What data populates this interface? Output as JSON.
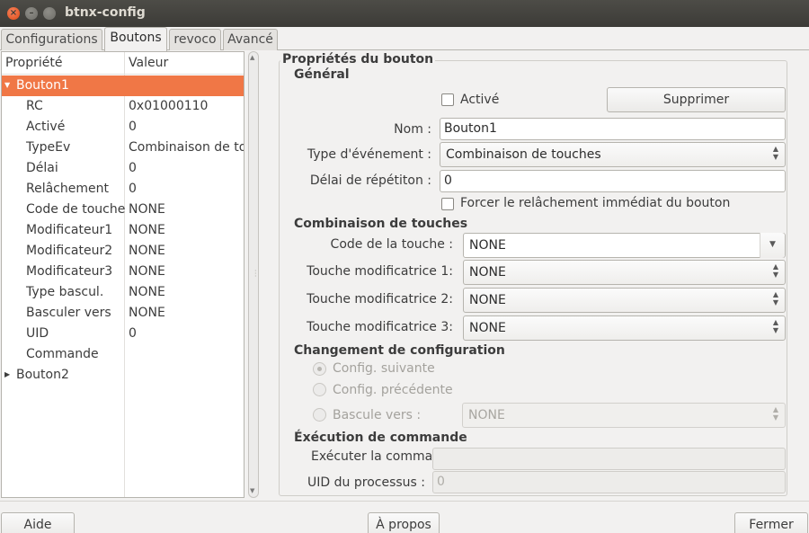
{
  "window": {
    "title": "btnx-config"
  },
  "tabs": [
    {
      "label": "Configurations"
    },
    {
      "label": "Boutons"
    },
    {
      "label": "revoco"
    },
    {
      "label": "Avancé"
    }
  ],
  "tree": {
    "headers": {
      "property": "Propriété",
      "value": "Valeur"
    },
    "rows": [
      {
        "prop": "Bouton1",
        "val": ""
      },
      {
        "prop": "RC",
        "val": "0x01000110"
      },
      {
        "prop": "Activé",
        "val": "0"
      },
      {
        "prop": "TypeEv",
        "val": "Combinaison de touches"
      },
      {
        "prop": "Délai",
        "val": "0"
      },
      {
        "prop": "Relâchement",
        "val": "0"
      },
      {
        "prop": "Code de touche",
        "val": "NONE"
      },
      {
        "prop": "Modificateur1",
        "val": "NONE"
      },
      {
        "prop": "Modificateur2",
        "val": "NONE"
      },
      {
        "prop": "Modificateur3",
        "val": "NONE"
      },
      {
        "prop": "Type bascul.",
        "val": "NONE"
      },
      {
        "prop": "Basculer vers",
        "val": "NONE"
      },
      {
        "prop": "UID",
        "val": "0"
      },
      {
        "prop": "Commande",
        "val": ""
      },
      {
        "prop": "Bouton2",
        "val": ""
      }
    ]
  },
  "props": {
    "frame_title": "Propriétés du bouton",
    "general": {
      "title": "Général",
      "enabled_label": "Activé",
      "enabled": false,
      "delete_label": "Supprimer",
      "name_label": "Nom :",
      "name_value": "Bouton1",
      "event_type_label": "Type d'événement :",
      "event_type_value": "Combinaison de touches",
      "repeat_delay_label": "Délai de répétiton :",
      "repeat_delay_value": "0",
      "force_release_label": "Forcer le relâchement immédiat du bouton"
    },
    "keycombo": {
      "title": "Combinaison de touches",
      "keycode_label": "Code de la touche :",
      "keycode_value": "NONE",
      "mod1_label": "Touche modificatrice 1:",
      "mod1_value": "NONE",
      "mod2_label": "Touche modificatrice 2:",
      "mod2_value": "NONE",
      "mod3_label": "Touche modificatrice 3:",
      "mod3_value": "NONE"
    },
    "config_switch": {
      "title": "Changement de configuration",
      "next_label": "Config. suivante",
      "prev_label": "Config. précédente",
      "toggle_label": "Bascule vers :",
      "toggle_value": "NONE"
    },
    "command": {
      "title": "Éxécution de commande",
      "exec_label": "Exécuter la commande :",
      "exec_value": "",
      "uid_label": "UID du processus :",
      "uid_value": "0"
    }
  },
  "buttons": {
    "help": "Aide",
    "about": "À propos",
    "close": "Fermer"
  },
  "colors": {
    "selection": "#f07746",
    "titlebar": "#3c3b37",
    "close_button": "#df4a16"
  }
}
